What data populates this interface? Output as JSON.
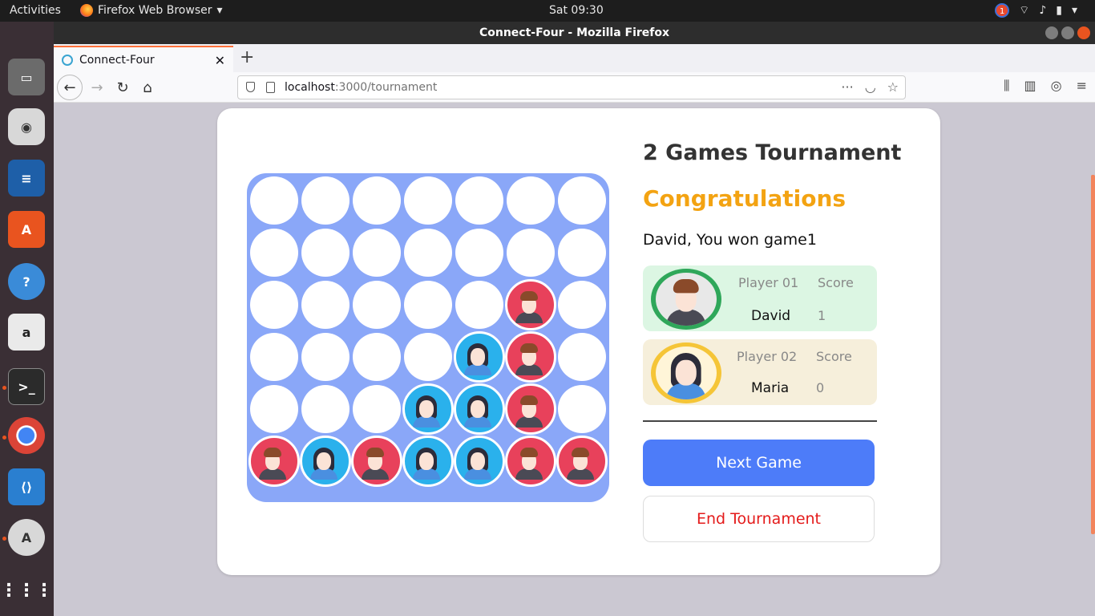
{
  "topbar": {
    "activities": "Activities",
    "app_name": "Firefox Web Browser",
    "clock": "Sat 09:30",
    "notification_count": "1"
  },
  "window": {
    "title": "Connect-Four - Mozilla Firefox"
  },
  "tab": {
    "title": "Connect-Four"
  },
  "url": {
    "host": "localhost",
    "rest": ":3000/tournament"
  },
  "game": {
    "title": "2 Games Tournament",
    "congrats": "Congratulations",
    "message": "David, You won game1",
    "players": [
      {
        "label": "Player 01",
        "score_label": "Score",
        "name": "David",
        "score": "1"
      },
      {
        "label": "Player 02",
        "score_label": "Score",
        "name": "Maria",
        "score": "0"
      }
    ],
    "next_label": "Next Game",
    "end_label": "End Tournament"
  },
  "board": {
    "rows": 6,
    "cols": 7,
    "cells": [
      [
        "",
        "",
        "",
        "",
        "",
        "",
        ""
      ],
      [
        "",
        "",
        "",
        "",
        "",
        "",
        ""
      ],
      [
        "",
        "",
        "",
        "",
        "",
        "red",
        ""
      ],
      [
        "",
        "",
        "",
        "",
        "blue",
        "red",
        ""
      ],
      [
        "",
        "",
        "",
        "blue",
        "blue",
        "red",
        ""
      ],
      [
        "red",
        "blue",
        "red",
        "blue",
        "blue",
        "red",
        "red"
      ]
    ]
  },
  "colors": {
    "board": "#8aa7f8",
    "player1": "#e8415b",
    "player2": "#2ab1ec",
    "accent": "#4d7cf9",
    "congrats": "#f3a312"
  }
}
